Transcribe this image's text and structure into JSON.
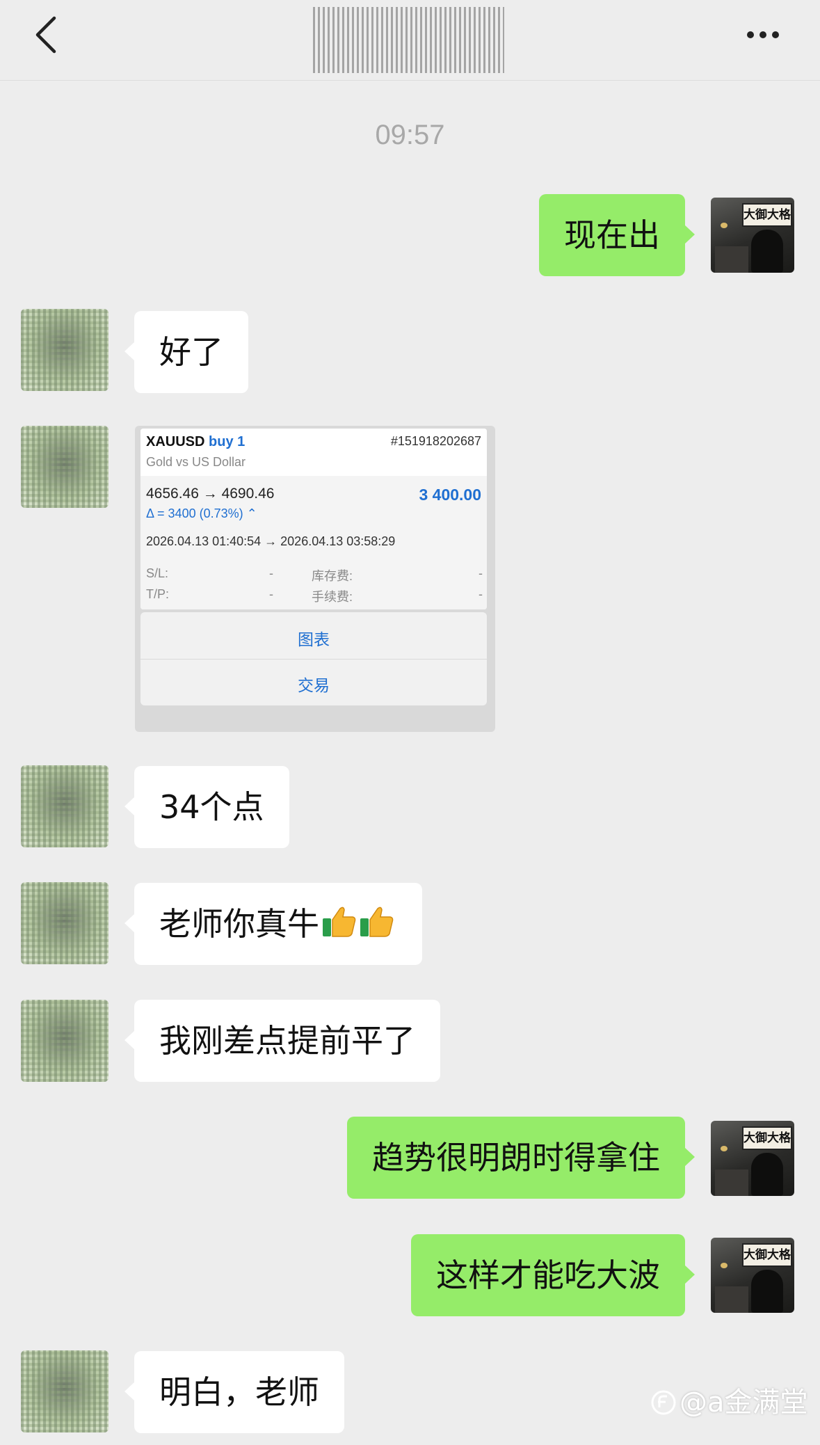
{
  "header": {
    "back_icon": "chevron-left-icon",
    "more_icon": "more-dots-icon"
  },
  "timestamp": "09:57",
  "messages": [
    {
      "side": "out",
      "text": "现在出"
    },
    {
      "side": "in",
      "text": "好了"
    },
    {
      "side": "in",
      "type": "image"
    },
    {
      "side": "in",
      "text": "34个点"
    },
    {
      "side": "in",
      "text": "老师你真牛",
      "emoji": "thumbs-up-icon x2"
    },
    {
      "side": "in",
      "text": "我刚差点提前平了"
    },
    {
      "side": "out",
      "text": "趋势很明朗时得拿住"
    },
    {
      "side": "out",
      "text": "这样才能吃大波"
    },
    {
      "side": "in",
      "text": "明白，老师"
    }
  ],
  "trade_card": {
    "symbol": "XAUUSD",
    "side": "buy 1",
    "order_id": "#151918202687",
    "description": "Gold vs US Dollar",
    "prices": "4656.46 → 4690.46",
    "profit": "3 400.00",
    "delta": "Δ = 3400 (0.73%) ⌃",
    "times": "2026.04.13 01:40:54 → 2026.04.13 03:58:29",
    "sl_label": "S/L:",
    "sl_value": "-",
    "tp_label": "T/P:",
    "tp_value": "-",
    "swap_label": "库存费:",
    "swap_value": "-",
    "fee_label": "手续费:",
    "fee_value": "-",
    "menu_chart": "图表",
    "menu_trade": "交易",
    "accent_color": "#1f6fd1"
  },
  "avatar_right_sign": "大御大格",
  "watermark": "@a金满堂",
  "colors": {
    "background": "#ededed",
    "outgoing_bubble": "#95ec69",
    "incoming_bubble": "#ffffff"
  }
}
